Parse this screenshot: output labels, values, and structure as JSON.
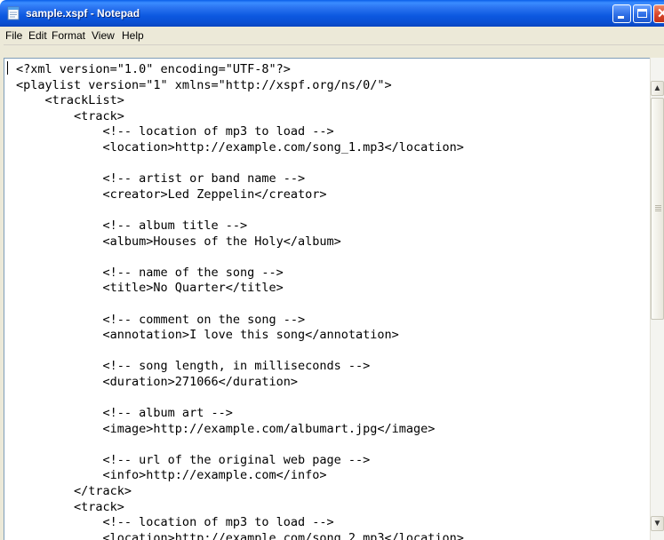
{
  "window": {
    "title": "sample.xspf - Notepad",
    "accent": "#0a58e0",
    "icons": {
      "app": "notepad-icon",
      "minimize": "minimize-icon",
      "maximize": "maximize-icon",
      "close": "close-icon"
    }
  },
  "menu": {
    "file": "File",
    "edit": "Edit",
    "format": "Format",
    "view": "View",
    "help": "Help"
  },
  "editor": {
    "lines": [
      "<?xml version=\"1.0\" encoding=\"UTF-8\"?>",
      "<playlist version=\"1\" xmlns=\"http://xspf.org/ns/0/\">",
      "    <trackList>",
      "        <track>",
      "            <!-- location of mp3 to load -->",
      "            <location>http://example.com/song_1.mp3</location>",
      "",
      "            <!-- artist or band name -->",
      "            <creator>Led Zeppelin</creator>",
      "",
      "            <!-- album title -->",
      "            <album>Houses of the Holy</album>",
      "",
      "            <!-- name of the song -->",
      "            <title>No Quarter</title>",
      "",
      "            <!-- comment on the song -->",
      "            <annotation>I love this song</annotation>",
      "",
      "            <!-- song length, in milliseconds -->",
      "            <duration>271066</duration>",
      "",
      "            <!-- album art -->",
      "            <image>http://example.com/albumart.jpg</image>",
      "",
      "            <!-- url of the original web page -->",
      "            <info>http://example.com</info>",
      "        </track>",
      "        <track>",
      "            <!-- location of mp3 to load -->",
      "            <location>http://example.com/song_2.mp3</location>"
    ]
  },
  "scrollbar": {
    "up_icon": "scroll-up-arrow-icon",
    "down_icon": "scroll-down-arrow-icon"
  }
}
